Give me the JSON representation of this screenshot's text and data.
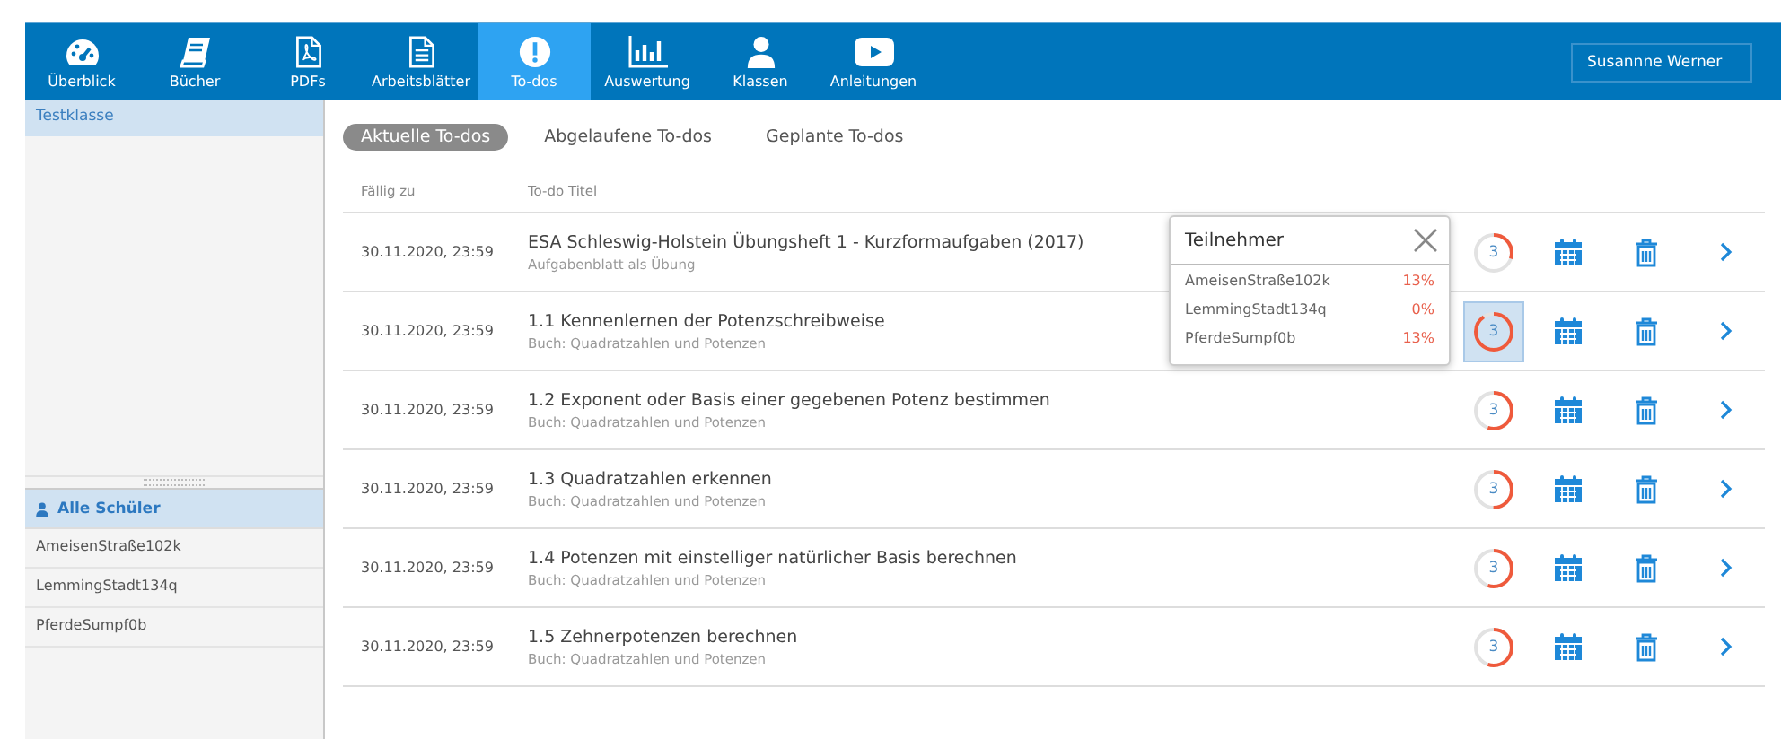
{
  "nav": {
    "items": [
      {
        "label": "Überblick",
        "selected": false
      },
      {
        "label": "Bücher",
        "selected": false
      },
      {
        "label": "PDFs",
        "selected": false
      },
      {
        "label": "Arbeitsblätter",
        "selected": false
      },
      {
        "label": "To-dos",
        "selected": true
      },
      {
        "label": "Auswertung",
        "selected": false
      },
      {
        "label": "Klassen",
        "selected": false
      },
      {
        "label": "Anleitungen",
        "selected": false
      }
    ],
    "user": "Susannne Werner"
  },
  "sidebar": {
    "classes": [
      {
        "label": "Testklasse",
        "selected": true
      }
    ],
    "students_header": {
      "label": "Alle Schüler",
      "selected": true
    },
    "students": [
      {
        "label": "AmeisenStraße102k",
        "selected": false
      },
      {
        "label": "LemmingStadt134q",
        "selected": false
      },
      {
        "label": "PferdeSumpf0b",
        "selected": false
      }
    ]
  },
  "tabs": [
    {
      "label": "Aktuelle To-dos",
      "selected": true
    },
    {
      "label": "Abgelaufene To-dos",
      "selected": false
    },
    {
      "label": "Geplante To-dos",
      "selected": false
    }
  ],
  "table": {
    "columns": [
      "Fällig zu",
      "To-do Titel"
    ],
    "rows": [
      {
        "due": "30.11.2020, 23:59",
        "title": "ESA Schleswig-Holstein Übungsheft 1 - Kurzformaufgaben (2017)",
        "subtitle": "Aufgabenblatt als Übung",
        "count": "3",
        "level": 0.3,
        "selected": false
      },
      {
        "due": "30.11.2020, 23:59",
        "title": "1.1 Kennenlernen der Potenzschreibweise",
        "subtitle": "Buch: Quadratzahlen und Potenzen",
        "count": "3",
        "level": 0.9,
        "selected": true
      },
      {
        "due": "30.11.2020, 23:59",
        "title": "1.2 Exponent oder Basis einer gegebenen Potenz bestimmen",
        "subtitle": "Buch: Quadratzahlen und Potenzen",
        "count": "3",
        "level": 0.55,
        "selected": false
      },
      {
        "due": "30.11.2020, 23:59",
        "title": "1.3 Quadratzahlen erkennen",
        "subtitle": "Buch: Quadratzahlen und Potenzen",
        "count": "3",
        "level": 0.5,
        "selected": false
      },
      {
        "due": "30.11.2020, 23:59",
        "title": "1.4 Potenzen mit einstelliger natürlicher Basis berechnen",
        "subtitle": "Buch: Quadratzahlen und Potenzen",
        "count": "3",
        "level": 0.55,
        "selected": false
      },
      {
        "due": "30.11.2020, 23:59",
        "title": "1.5 Zehnerpotenzen berechnen",
        "subtitle": "Buch: Quadratzahlen und Potenzen",
        "count": "3",
        "level": 0.55,
        "selected": false
      }
    ]
  },
  "popup": {
    "title": "Teilnehmer",
    "participants": [
      {
        "name": "AmeisenStraße102k",
        "percent": "13%"
      },
      {
        "name": "LemmingStadt134q",
        "percent": "0%"
      },
      {
        "name": "PferdeSumpf0b",
        "percent": "13%"
      }
    ]
  }
}
